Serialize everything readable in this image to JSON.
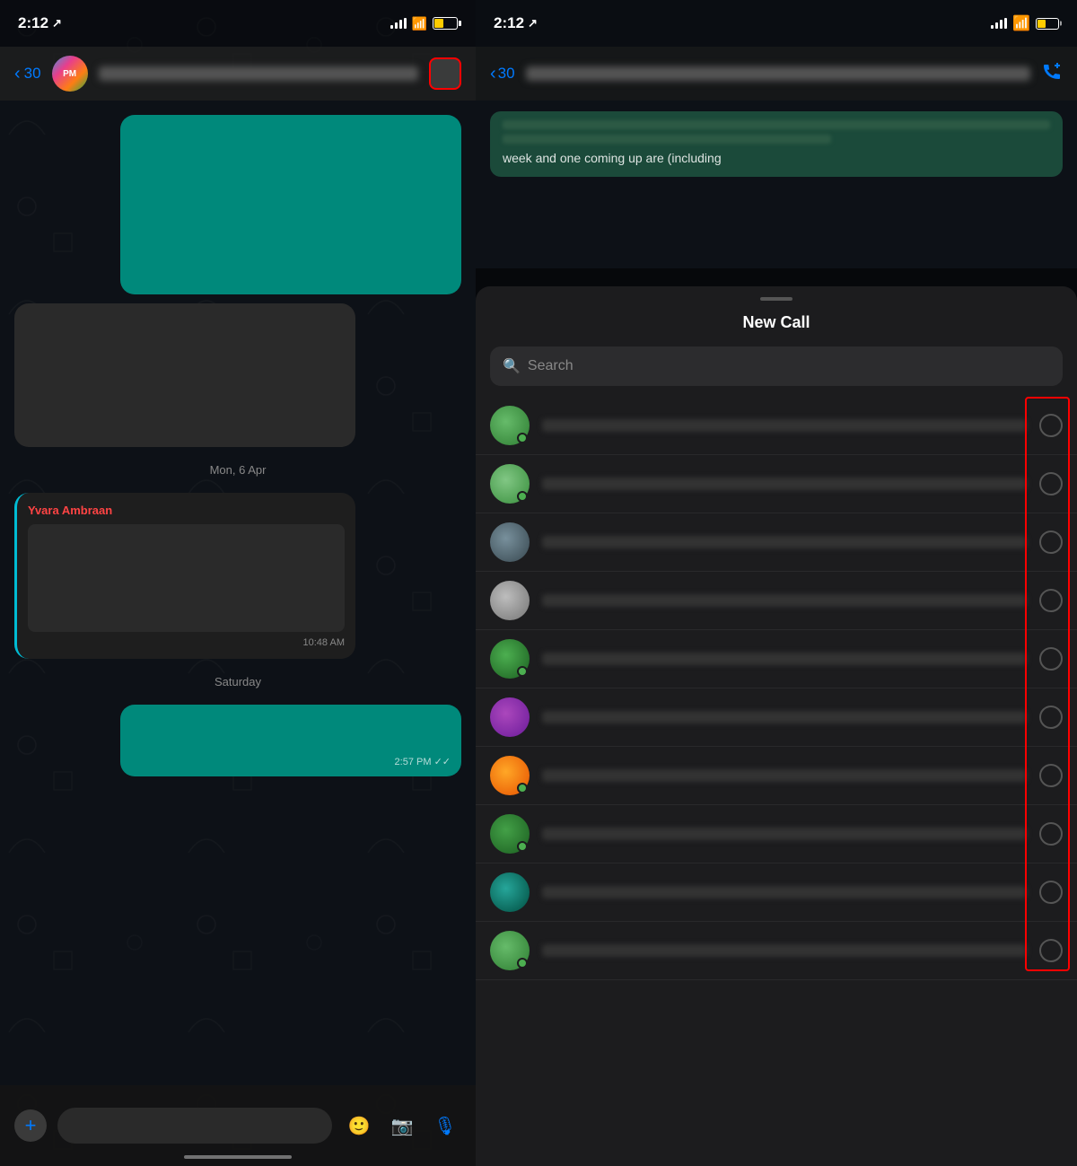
{
  "left": {
    "status_bar": {
      "time": "2:12",
      "location_icon": "↗",
      "battery_level_pct": 40
    },
    "header": {
      "back_label": "30",
      "action_button": "video-icon"
    },
    "messages": [
      {
        "type": "bubble_teal",
        "id": "msg1"
      },
      {
        "type": "bubble_dark",
        "id": "msg2"
      },
      {
        "type": "date_sep",
        "label": "Mon, 6 Apr"
      },
      {
        "type": "bubble_named",
        "sender": "Yvara Ambraan",
        "time": "10:48 AM",
        "id": "msg4"
      },
      {
        "type": "date_sep",
        "label": "Saturday"
      },
      {
        "type": "bubble_teal_out",
        "time": "2:57 PM",
        "ticks": "✓✓",
        "id": "msg6"
      }
    ],
    "input_bar": {
      "plus_label": "+",
      "emoji_label": "🙂",
      "camera_label": "📷",
      "mic_label": "🎙"
    }
  },
  "right": {
    "status_bar": {
      "time": "2:12",
      "location_icon": "↗",
      "battery_level_pct": 40
    },
    "header": {
      "back_label": "30",
      "new_call_icon": "📞+"
    },
    "partial_message": {
      "lines": [
        "week and one coming up are (including"
      ]
    },
    "modal": {
      "handle": true,
      "title": "New Call",
      "search": {
        "icon": "🔍",
        "placeholder": "Search"
      },
      "contacts": [
        {
          "id": "c1",
          "avatar_class": "avatar-green1",
          "online": true,
          "name_width": "medium"
        },
        {
          "id": "c2",
          "avatar_class": "avatar-green2",
          "online": true,
          "name_width": "short"
        },
        {
          "id": "c3",
          "avatar_class": "avatar-blue-grey",
          "online": false,
          "name_width": "medium"
        },
        {
          "id": "c4",
          "avatar_class": "avatar-light-grey",
          "online": false,
          "name_width": "long"
        },
        {
          "id": "c5",
          "avatar_class": "avatar-green3",
          "online": true,
          "name_width": "short"
        },
        {
          "id": "c6",
          "avatar_class": "avatar-mixed",
          "online": false,
          "name_width": "medium"
        },
        {
          "id": "c7",
          "avatar_class": "avatar-orange",
          "online": true,
          "name_width": "short"
        },
        {
          "id": "c8",
          "avatar_class": "avatar-green4",
          "online": true,
          "name_width": "medium"
        },
        {
          "id": "c9",
          "avatar_class": "avatar-teal",
          "online": false,
          "name_width": "short"
        },
        {
          "id": "c10",
          "avatar_class": "avatar-green5",
          "online": true,
          "name_width": "medium"
        }
      ]
    }
  }
}
